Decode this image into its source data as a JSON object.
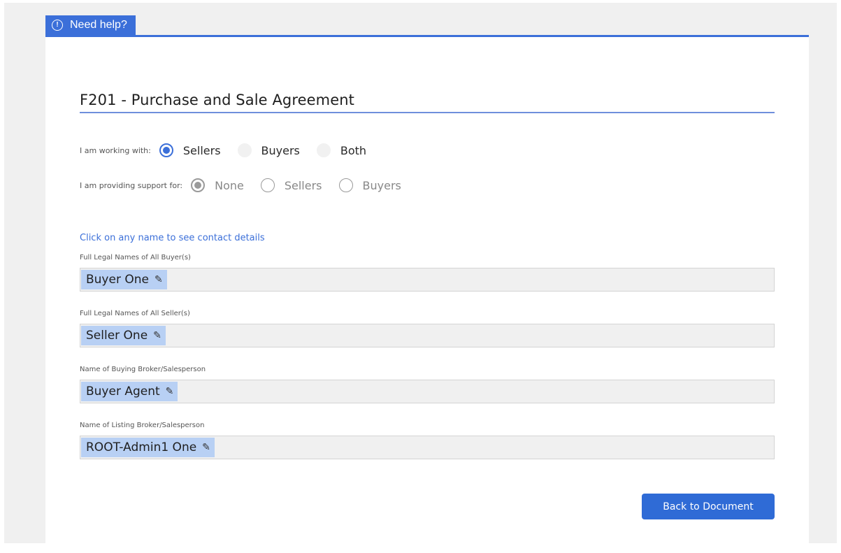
{
  "help": {
    "label": "Need help?",
    "icon": "!"
  },
  "form": {
    "title": "F201 - Purchase and Sale Agreement",
    "working_with": {
      "label": "I am working with:",
      "options": [
        "Sellers",
        "Buyers",
        "Both"
      ],
      "selected": "Sellers"
    },
    "support_for": {
      "label": "I am providing support for:",
      "options": [
        "None",
        "Sellers",
        "Buyers"
      ],
      "selected": "None"
    },
    "hint": "Click on any name to see contact details",
    "fields": [
      {
        "label": "Full Legal Names of All Buyer(s)",
        "value": "Buyer One"
      },
      {
        "label": "Full Legal Names of All Seller(s)",
        "value": "Seller One"
      },
      {
        "label": "Name of Buying Broker/Salesperson",
        "value": "Buyer Agent"
      },
      {
        "label": "Name of Listing Broker/Salesperson",
        "value": "ROOT-Admin1 One"
      }
    ],
    "back_button": "Back to Document"
  },
  "colors": {
    "accent": "#3b6fd9",
    "chip": "#b8d0f4",
    "field_bg": "#f0f0f0"
  }
}
